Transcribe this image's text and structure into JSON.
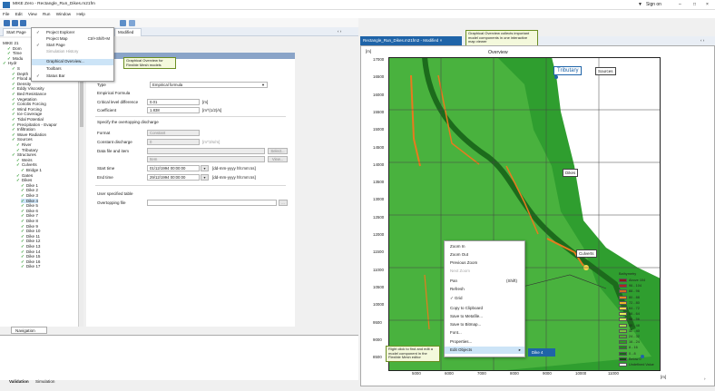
{
  "window": {
    "title": "MIKE Zero - Rectangle_Run_Dikes.m21fm",
    "sign_in": "Sign on"
  },
  "menubar": {
    "items": [
      "File",
      "Edit",
      "View",
      "Run",
      "Window",
      "Help"
    ]
  },
  "tabs": {
    "start_page": "Start Page",
    "modified": "Modified"
  },
  "view_menu": {
    "items": [
      {
        "label": "Project Explorer",
        "checked": true,
        "state": "normal"
      },
      {
        "label": "Project Map",
        "shortcut": "Ctrl+Shift+M",
        "state": "normal"
      },
      {
        "label": "Start Page",
        "checked": true,
        "state": "normal"
      },
      {
        "label": "Simulation History",
        "state": "disabled"
      },
      {
        "label": "Graphical Overview...",
        "state": "highlighted"
      },
      {
        "label": "Toolbars",
        "state": "normal"
      },
      {
        "label": "Status Bar",
        "checked": true,
        "state": "normal"
      }
    ],
    "tooltip": "Graphical Overview for Flexible Mesh models"
  },
  "tree": {
    "items": [
      {
        "label": "MIKE 21",
        "indent": 0,
        "checked": false
      },
      {
        "label": "Dom",
        "indent": 1,
        "checked": true
      },
      {
        "label": "Time",
        "indent": 1,
        "checked": true
      },
      {
        "label": "Modu",
        "indent": 1,
        "checked": true
      },
      {
        "label": "Hydr",
        "indent": 0,
        "checked": true
      },
      {
        "label": "S",
        "indent": 2,
        "checked": true
      },
      {
        "label": "Depth",
        "indent": 2,
        "checked": true
      },
      {
        "label": "Flood and Dry",
        "indent": 2,
        "checked": true
      },
      {
        "label": "Density",
        "indent": 2,
        "checked": true
      },
      {
        "label": "Eddy Viscosity",
        "indent": 2,
        "checked": true
      },
      {
        "label": "Bed Resistance",
        "indent": 2,
        "checked": true
      },
      {
        "label": "Vegetation",
        "indent": 2,
        "checked": true
      },
      {
        "label": "Coriolis Forcing",
        "indent": 2,
        "checked": true
      },
      {
        "label": "Wind Forcing",
        "indent": 2,
        "checked": true
      },
      {
        "label": "Ice Coverage",
        "indent": 2,
        "checked": true
      },
      {
        "label": "Tidal Potential",
        "indent": 2,
        "checked": true
      },
      {
        "label": "Precipitation - Evapor",
        "indent": 2,
        "checked": true
      },
      {
        "label": "Infiltration",
        "indent": 2,
        "checked": true
      },
      {
        "label": "Wave Radiation",
        "indent": 2,
        "checked": true
      },
      {
        "label": "Sources",
        "indent": 2,
        "checked": true
      },
      {
        "label": "River",
        "indent": 3,
        "checked": true
      },
      {
        "label": "Tributary",
        "indent": 3,
        "checked": true
      },
      {
        "label": "Structures",
        "indent": 2,
        "checked": true
      },
      {
        "label": "Weirs",
        "indent": 3,
        "checked": true
      },
      {
        "label": "Culverts",
        "indent": 3,
        "checked": true
      },
      {
        "label": "Bridge 1",
        "indent": 4,
        "checked": true
      },
      {
        "label": "Gates",
        "indent": 3,
        "checked": true
      },
      {
        "label": "Dikes",
        "indent": 3,
        "checked": true
      },
      {
        "label": "Dike 1",
        "indent": 4,
        "checked": true
      },
      {
        "label": "Dike 2",
        "indent": 4,
        "checked": true
      },
      {
        "label": "Dike 3",
        "indent": 4,
        "checked": true
      },
      {
        "label": "Dike 4",
        "indent": 4,
        "checked": true,
        "selected": true
      },
      {
        "label": "Dike 5",
        "indent": 4,
        "checked": true
      },
      {
        "label": "Dike 6",
        "indent": 4,
        "checked": true
      },
      {
        "label": "Dike 7",
        "indent": 4,
        "checked": true
      },
      {
        "label": "Dike 8",
        "indent": 4,
        "checked": true
      },
      {
        "label": "Dike 9",
        "indent": 4,
        "checked": true
      },
      {
        "label": "Dike 10",
        "indent": 4,
        "checked": true
      },
      {
        "label": "Dike 11",
        "indent": 4,
        "checked": true
      },
      {
        "label": "Dike 12",
        "indent": 4,
        "checked": true
      },
      {
        "label": "Dike 13",
        "indent": 4,
        "checked": true
      },
      {
        "label": "Dike 14",
        "indent": 4,
        "checked": true
      },
      {
        "label": "Dike 15",
        "indent": 4,
        "checked": true
      },
      {
        "label": "Dike 16",
        "indent": 4,
        "checked": true
      },
      {
        "label": "Dike 17",
        "indent": 4,
        "checked": true
      }
    ]
  },
  "navigation_tab": "Navigation",
  "bottom_tabs": {
    "validation": "Validation",
    "simulation": "Simulation"
  },
  "props": {
    "type_label": "Type",
    "type_value": "Empirical formula",
    "section_formula": "Empirical Formula",
    "crit_label": "Critical level difference",
    "crit_value": "0.01",
    "crit_unit": "[m]",
    "coef_label": "Coefficient",
    "coef_value": "1.838",
    "coef_unit": "[m^(1/2)/s]",
    "section_overtop": "Specify the overtopping discharge",
    "format_label": "Format",
    "format_value": "Constant",
    "const_label": "Constant discharge",
    "const_value": "0",
    "const_unit": "[m^3/s/m]",
    "file_label": "Data file and item",
    "select_btn": "Select...",
    "item_value": "Item",
    "view_btn": "View...",
    "start_label": "Start time",
    "start_value": "01/12/1994 00:00:00",
    "start_fmt": "[dd-mm-yyyy hh:mm:ss]",
    "end_label": "End time",
    "end_value": "29/12/1994 00:00:00",
    "end_fmt": "[dd-mm-yyyy hh:mm:ss]",
    "section_table": "User specified table",
    "overtop_label": "Overtopping file",
    "browse_btn": "..."
  },
  "map": {
    "tab_label": "Rectangle_Run_Dikes.m21fm2 - Modified",
    "tab_tooltip": "Graphical Overview collects important model components in one interactive map viewer",
    "unit_top": "[m]",
    "overview_title": "Overview",
    "y_ticks": [
      "17000",
      "16500",
      "16000",
      "15500",
      "15000",
      "14500",
      "14000",
      "13500",
      "13000",
      "12500",
      "12000",
      "11500",
      "11000",
      "10500",
      "10000",
      "9500",
      "9000",
      "8500"
    ],
    "x_ticks": [
      "5000",
      "6000",
      "7000",
      "8000",
      "9000",
      "10000",
      "11000"
    ],
    "x_unit": "[m]",
    "labels": {
      "tributary": "Tributary",
      "sources": "Sources",
      "dikes": "Dikes",
      "culverts": "Culverts"
    },
    "bottom_tooltip": "Right click to find and edit a model component in the Flexible Mesh editor"
  },
  "context_menu": {
    "items": [
      {
        "label": "Zoom In",
        "state": "normal"
      },
      {
        "label": "Zoom Out",
        "state": "normal"
      },
      {
        "label": "Previous Zoom",
        "state": "normal"
      },
      {
        "label": "Next Zoom",
        "state": "disabled"
      },
      {
        "label": "Pan",
        "shortcut": "(Shift)",
        "state": "normal"
      },
      {
        "label": "Refresh",
        "state": "normal"
      },
      {
        "label": "Grid",
        "checked": true,
        "state": "normal"
      },
      {
        "label": "Copy to Clipboard",
        "state": "normal"
      },
      {
        "label": "Save to Metafile...",
        "state": "normal"
      },
      {
        "label": "Save to Bitmap...",
        "state": "normal"
      },
      {
        "label": "Font...",
        "state": "normal"
      },
      {
        "label": "Properties...",
        "state": "normal"
      },
      {
        "label": "Edit Objects",
        "state": "highlighted"
      }
    ],
    "submenu_item": "Dike 4"
  },
  "legend": {
    "title": "Bathymetry",
    "entries": [
      {
        "label": "Above 104",
        "color": "#8b1a1a"
      },
      {
        "label": "96 - 104",
        "color": "#b22222"
      },
      {
        "label": "88 - 96",
        "color": "#d2691e"
      },
      {
        "label": "80 - 88",
        "color": "#e08a1e"
      },
      {
        "label": "72 - 80",
        "color": "#f0b429"
      },
      {
        "label": "64 - 72",
        "color": "#f7d84b"
      },
      {
        "label": "56 - 64",
        "color": "#e6ef5a"
      },
      {
        "label": "48 - 56",
        "color": "#c7e85a"
      },
      {
        "label": "40 - 48",
        "color": "#a6d94e"
      },
      {
        "label": "32 - 40",
        "color": "#7cc43e"
      },
      {
        "label": "24 - 32",
        "color": "#4faf2e"
      },
      {
        "label": "16 - 24",
        "color": "#2e9a22"
      },
      {
        "label": "8 - 16",
        "color": "#1f8a1a"
      },
      {
        "label": "0 - 8",
        "color": "#146c14"
      },
      {
        "label": "Below 0",
        "color": "#0b4d0b"
      },
      {
        "label": "Undefined Value",
        "color": "#ffffff"
      }
    ]
  },
  "colors": {
    "accent": "#1f64a8",
    "mesh_green": "#2f9e2f",
    "dike_orange": "#e87a1e"
  }
}
